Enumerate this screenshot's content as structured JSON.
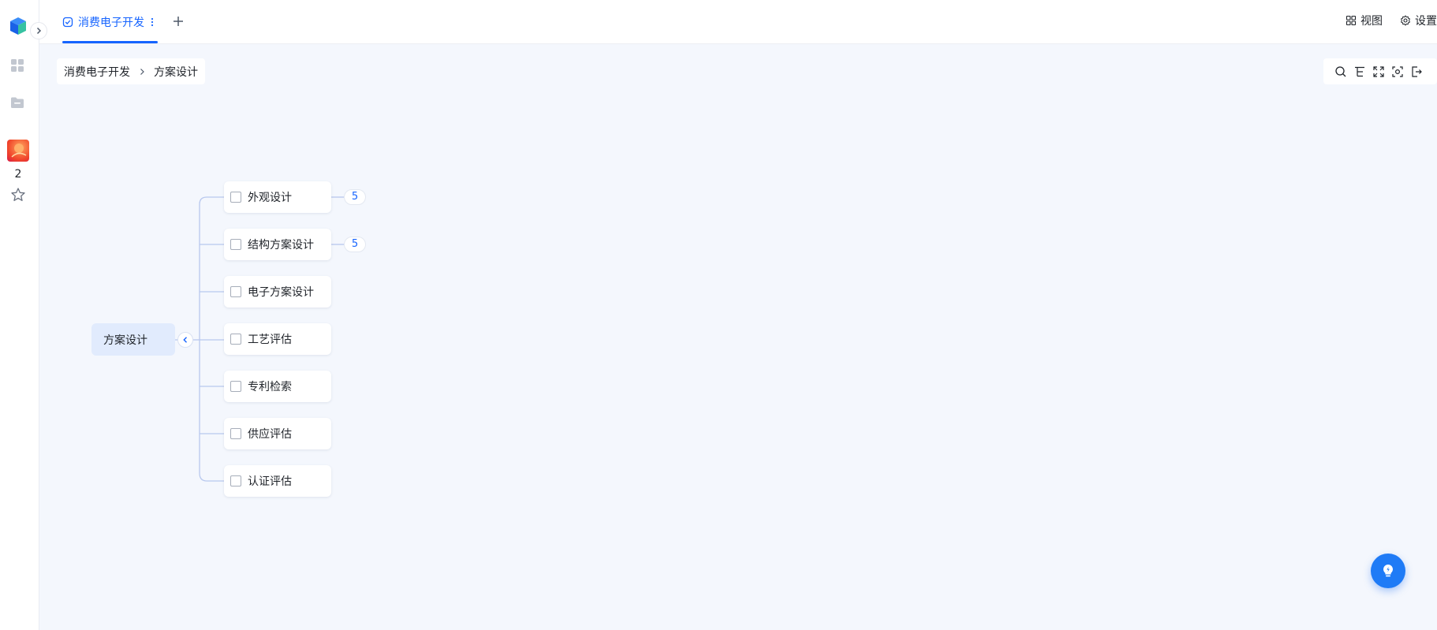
{
  "tabs": [
    {
      "label": "消费电子开发",
      "active": true
    }
  ],
  "topright": {
    "view_label": "视图",
    "settings_label": "设置"
  },
  "rail": {
    "unread_count": "2"
  },
  "breadcrumb": [
    "消费电子开发",
    "方案设计"
  ],
  "mindmap": {
    "root": "方案设计",
    "children": [
      {
        "label": "外观设计",
        "badge": "5"
      },
      {
        "label": "结构方案设计",
        "badge": "5"
      },
      {
        "label": "电子方案设计"
      },
      {
        "label": "工艺评估"
      },
      {
        "label": "专利检索"
      },
      {
        "label": "供应评估"
      },
      {
        "label": "认证评估"
      }
    ]
  },
  "colors": {
    "accent": "#1664ff",
    "root_bg": "#e1ebfd",
    "canvas_bg": "#f4f7fd",
    "connector": "#b8c8ee"
  },
  "icons": {
    "logo": "cube-logo-icon",
    "apps": "apps-grid-icon",
    "folder": "folder-icon",
    "star": "star-icon",
    "search": "search-icon",
    "tree": "tree-structure-icon",
    "fullscreen": "fullscreen-icon",
    "focus": "focus-icon",
    "exit": "exit-icon",
    "bulb": "lightbulb-icon"
  }
}
